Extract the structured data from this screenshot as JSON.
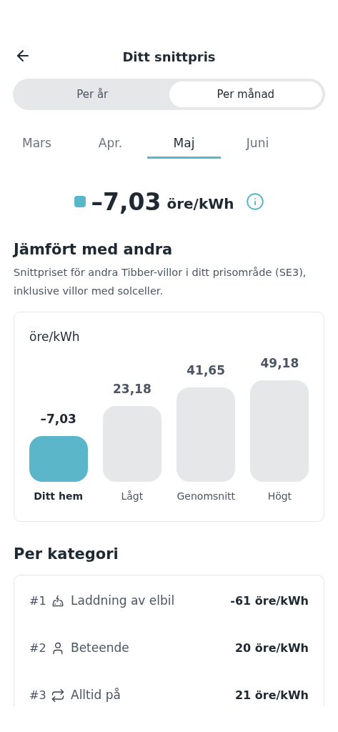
{
  "header": {
    "title": "Ditt snittpris"
  },
  "period_toggle": [
    {
      "label": "Per år",
      "selected": false
    },
    {
      "label": "Per månad",
      "selected": true
    }
  ],
  "months": [
    {
      "label": "Mars",
      "selected": false
    },
    {
      "label": "Apr.",
      "selected": false
    },
    {
      "label": "Maj",
      "selected": true
    },
    {
      "label": "Juni",
      "selected": false
    }
  ],
  "summary": {
    "color": "#5bb6c9",
    "value": "–7,03",
    "unit": "öre/kWh"
  },
  "comparison": {
    "title": "Jämfört med andra",
    "description": "Snittpriset för andra Tibber-villor i ditt prisområde (SE3), inklusive villor med solceller.",
    "unit": "öre/kWh",
    "bars": [
      {
        "label": "Ditt hem",
        "value": "–7,03",
        "selected": true
      },
      {
        "label": "Lågt",
        "value": "23,18",
        "selected": false
      },
      {
        "label": "Genomsnitt",
        "value": "41,65",
        "selected": false
      },
      {
        "label": "Högt",
        "value": "49,18",
        "selected": false
      }
    ]
  },
  "categories": {
    "title": "Per kategori",
    "items": [
      {
        "rank": "#1",
        "kind": "car",
        "label": "Laddning av elbil",
        "value": "-61 öre/kWh"
      },
      {
        "rank": "#2",
        "kind": "person",
        "label": "Beteende",
        "value": "20 öre/kWh"
      },
      {
        "rank": "#3",
        "kind": "repeat",
        "label": "Alltid på",
        "value": "21 öre/kWh"
      }
    ]
  }
}
